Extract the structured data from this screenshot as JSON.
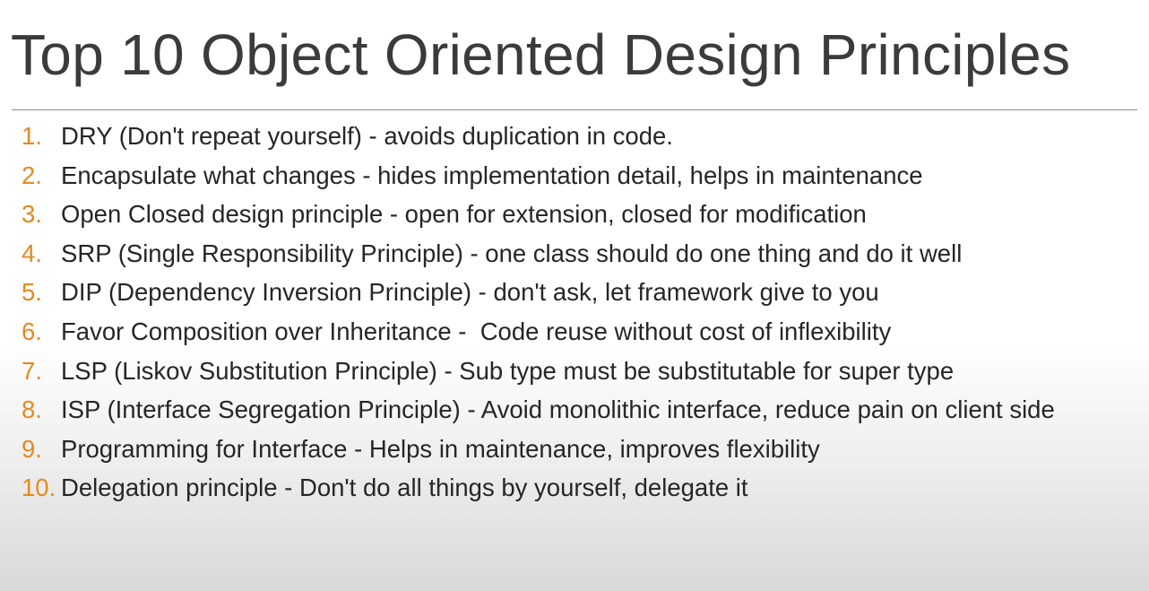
{
  "slide": {
    "title": "Top 10 Object Oriented Design Principles",
    "principles": [
      {
        "number": "1.",
        "text": "DRY (Don't repeat yourself) - avoids duplication in code."
      },
      {
        "number": "2.",
        "text": "Encapsulate what changes - hides implementation detail, helps in maintenance"
      },
      {
        "number": "3.",
        "text": "Open Closed design principle - open for extension, closed for modification"
      },
      {
        "number": "4.",
        "text": "SRP (Single Responsibility Principle) - one class should do one thing and do it well"
      },
      {
        "number": "5.",
        "text": "DIP (Dependency Inversion Principle) - don't ask, let framework give to you"
      },
      {
        "number": "6.",
        "text": "Favor Composition over Inheritance -  Code reuse without cost of inflexibility"
      },
      {
        "number": "7.",
        "text": "LSP (Liskov Substitution Principle) - Sub type must be substitutable for super type"
      },
      {
        "number": "8.",
        "text": "ISP (Interface Segregation Principle) - Avoid monolithic interface, reduce pain on client side"
      },
      {
        "number": "9.",
        "text": "Programming for Interface - Helps in maintenance, improves flexibility"
      },
      {
        "number": "10.",
        "text": "Delegation principle - Don't do all things by yourself, delegate it"
      }
    ]
  },
  "colors": {
    "number_accent": "#e6891c",
    "body_text": "#262626",
    "title_text": "#3b3b3b"
  }
}
